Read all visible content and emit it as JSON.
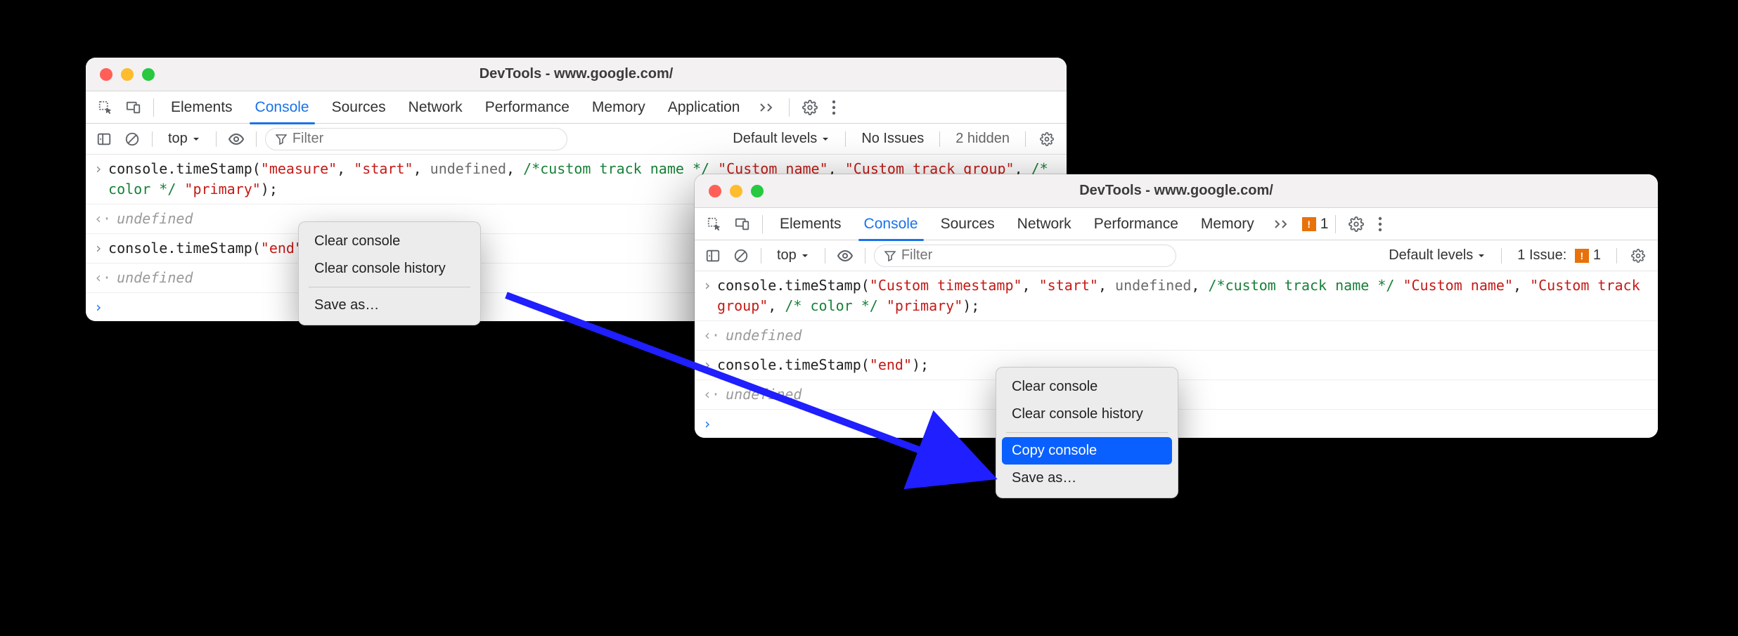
{
  "windows": {
    "left": {
      "title": "DevTools - www.google.com/",
      "tabs": [
        "Elements",
        "Console",
        "Sources",
        "Network",
        "Performance",
        "Memory",
        "Application"
      ],
      "activeTab": "Console",
      "toolbar": {
        "context": "top",
        "filter_placeholder": "Filter",
        "levels": "Default levels",
        "issues": "No Issues",
        "hidden": "2 hidden"
      },
      "console": {
        "line1_parts": {
          "prefix": "console.timeStamp(",
          "arg1": "\"measure\"",
          "sep1": ", ",
          "arg2": "\"start\"",
          "sep2": ", ",
          "arg3": "undefined",
          "sep3": ", ",
          "comment1": "/*custom track name */",
          "arg4": "\"Custom name\"",
          "sep4": ", ",
          "arg5": "\"Custom track group\"",
          "sep5": ", ",
          "comment2": "/* color */",
          "sp": " ",
          "arg6": "\"primary\"",
          "suffix": ");"
        },
        "undef": "undefined",
        "line2_prefix": "console.timeStamp(",
        "line2_arg": "\"end\"",
        "line2_suffix": ");"
      },
      "menu": {
        "item1": "Clear console",
        "item2": "Clear console history",
        "item3": "Save as…"
      }
    },
    "right": {
      "title": "DevTools - www.google.com/",
      "tabs": [
        "Elements",
        "Console",
        "Sources",
        "Network",
        "Performance",
        "Memory"
      ],
      "activeTab": "Console",
      "tabIssueCount": "1",
      "toolbar": {
        "context": "top",
        "filter_placeholder": "Filter",
        "levels": "Default levels",
        "issues_label": "1 Issue:",
        "issues_count": "1"
      },
      "console": {
        "line1_parts": {
          "prefix": "console.timeStamp(",
          "arg1": "\"Custom timestamp\"",
          "sep1": ", ",
          "arg2": "\"start\"",
          "sep2": ", ",
          "arg3": "undefined",
          "sep3": ", ",
          "comment1": "/*custom track name */",
          "sp1": " ",
          "arg4": "\"Custom name\"",
          "sep4": ", ",
          "arg5": "\"Custom track group\"",
          "sep5": ", ",
          "comment2": "/* color */",
          "sp2": " ",
          "arg6": "\"primary\"",
          "suffix": ");"
        },
        "undef": "undefined",
        "line2_prefix": "console.timeStamp(",
        "line2_arg": "\"end\"",
        "line2_suffix": ");"
      },
      "menu": {
        "item1": "Clear console",
        "item2": "Clear console history",
        "item3": "Copy console",
        "item4": "Save as…"
      }
    }
  }
}
